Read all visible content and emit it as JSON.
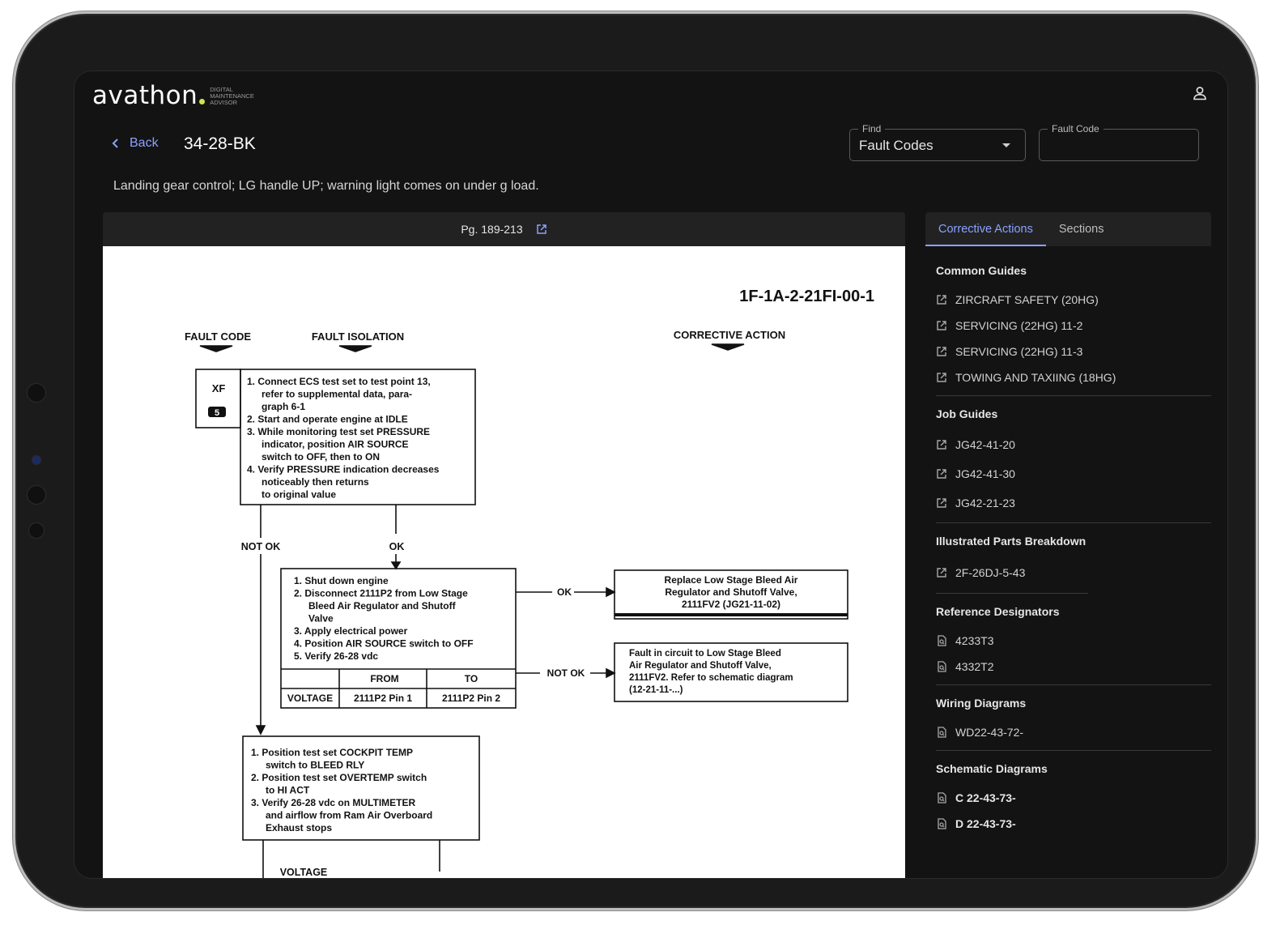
{
  "app": {
    "logo_word": "avathon",
    "logo_tagline": [
      "DIGITAL",
      "MAINTENANCE",
      "ADVISOR"
    ]
  },
  "header": {
    "back_label": "Back",
    "fault_id": "34-28-BK",
    "description": "Landing gear control; LG handle UP; warning light comes on under g load."
  },
  "find": {
    "label": "Find",
    "value": "Fault Codes"
  },
  "fault_code_field": {
    "label": "Fault Code",
    "value": ""
  },
  "viewer": {
    "page_range": "Pg. 189-213"
  },
  "document": {
    "doc_number": "1F-1A-2-21FI-00-1",
    "col_fault_code": "FAULT CODE",
    "col_fault_isolation": "FAULT ISOLATION",
    "col_corrective_action": "CORRECTIVE ACTION",
    "code_letters": "XF",
    "code_number": "5",
    "step1": [
      "1. Connect ECS test set to test point 13,",
      "refer to supplemental data, para-",
      "graph 6-1",
      "2. Start and operate engine at IDLE",
      "3. While monitoring test set PRESSURE",
      "indicator, position AIR SOURCE",
      "switch to OFF, then to ON",
      "4. Verify PRESSURE indication decreases",
      "noticeably then returns",
      "to original value"
    ],
    "not_ok": "NOT OK",
    "ok": "OK",
    "step2": [
      "1. Shut down engine",
      "2. Disconnect 2111P2 from Low Stage",
      "Bleed Air Regulator and Shutoff",
      "Valve",
      "3. Apply electrical power",
      "4. Position AIR SOURCE switch to OFF",
      "5. Verify 26-28 vdc"
    ],
    "table_from": "FROM",
    "table_to": "TO",
    "table_voltage": "VOLTAGE",
    "table_from_val": "2111P2 Pin 1",
    "table_to_val": "2111P2 Pin 2",
    "action_ok": [
      "Replace Low Stage Bleed Air",
      "Regulator and Shutoff Valve,",
      "2111FV2 (JG21-11-02)"
    ],
    "action_not_ok": [
      "Fault in circuit to Low Stage Bleed",
      "Air Regulator and Shutoff Valve,",
      "2111FV2. Refer to schematic diagram",
      "(12-21-11-...)"
    ],
    "step3": [
      "1. Position test set COCKPIT TEMP",
      "switch to BLEED RLY",
      "2. Position test set OVERTEMP switch",
      "to HI ACT",
      "3. Verify 26-28 vdc on MULTIMETER",
      "and airflow from Ram Air Overboard",
      "Exhaust stops"
    ],
    "voltage_bottom": "VOLTAGE"
  },
  "panel": {
    "tabs": [
      "Corrective Actions",
      "Sections"
    ],
    "common_guides": {
      "title": "Common Guides",
      "items": [
        "ZIRCRAFT SAFETY (20HG)",
        "SERVICING (22HG) 11-2",
        "SERVICING (22HG) 11-3",
        "TOWING AND TAXIING (18HG)"
      ]
    },
    "job_guides": {
      "title": "Job Guides",
      "items": [
        "JG42-41-20",
        "JG42-41-30",
        "JG42-21-23"
      ]
    },
    "ipb": {
      "title": "Illustrated Parts Breakdown",
      "items": [
        "2F-26DJ-5-43"
      ]
    },
    "ref_designators": {
      "title": "Reference Designators",
      "items": [
        "4233T3",
        "4332T2"
      ]
    },
    "wiring": {
      "title": "Wiring Diagrams",
      "items": [
        "WD22-43-72-"
      ]
    },
    "schematic": {
      "title": "Schematic Diagrams",
      "items": [
        "C 22-43-73-",
        "D 22-43-73-"
      ]
    }
  },
  "colors": {
    "accent": "#8aa3ff",
    "background": "#131313",
    "logo_dot": "#c9e84a"
  }
}
